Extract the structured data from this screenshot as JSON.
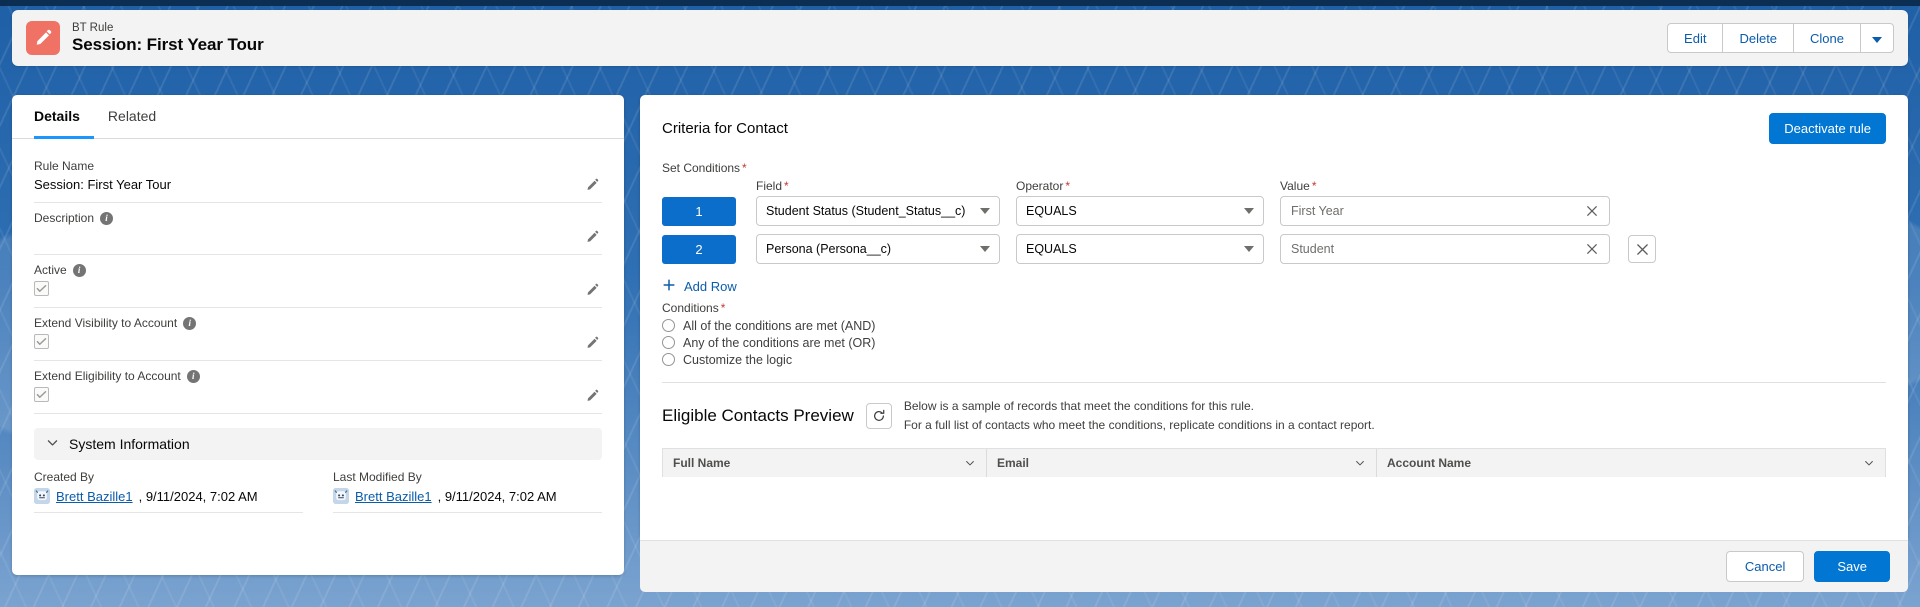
{
  "header": {
    "object_icon": "pencil-icon",
    "eyebrow": "BT Rule",
    "title": "Session: First Year Tour",
    "actions": {
      "edit": "Edit",
      "delete": "Delete",
      "clone": "Clone",
      "more": "chevron-down-icon"
    }
  },
  "details": {
    "tabs": [
      {
        "label": "Details",
        "active": true
      },
      {
        "label": "Related",
        "active": false
      }
    ],
    "fields": [
      {
        "label": "Rule Name",
        "value": "Session: First Year Tour",
        "type": "text",
        "has_info": false
      },
      {
        "label": "Description",
        "value": "",
        "type": "text",
        "has_info": true
      },
      {
        "label": "Active",
        "value": "",
        "type": "checkbox",
        "checked": true,
        "has_info": true
      },
      {
        "label": "Extend Visibility to Account",
        "value": "",
        "type": "checkbox",
        "checked": true,
        "has_info": true
      },
      {
        "label": "Extend Eligibility to Account",
        "value": "",
        "type": "checkbox",
        "checked": true,
        "has_info": true
      }
    ],
    "system_information": {
      "section_title": "System Information",
      "created_by": {
        "label": "Created By",
        "user": "Brett Bazille1",
        "timestamp": ", 9/11/2024, 7:02 AM"
      },
      "last_modified_by": {
        "label": "Last Modified By",
        "user": "Brett Bazille1",
        "timestamp": ", 9/11/2024, 7:02 AM"
      }
    }
  },
  "criteria": {
    "title": "Criteria for Contact",
    "deactivate_label": "Deactivate rule",
    "set_conditions_label": "Set Conditions",
    "column_headers": {
      "field": "Field",
      "operator": "Operator",
      "value": "Value"
    },
    "rows": [
      {
        "index": "1",
        "field": "Student Status (Student_Status__c)",
        "operator": "EQUALS",
        "value": "First Year",
        "has_delete": false
      },
      {
        "index": "2",
        "field": "Persona (Persona__c)",
        "operator": "EQUALS",
        "value": "Student",
        "has_delete": true
      }
    ],
    "add_row_label": "Add Row",
    "conditions_label": "Conditions",
    "condition_options": [
      {
        "label": "All of the conditions are met (AND)",
        "selected": false
      },
      {
        "label": "Any of the conditions are met (OR)",
        "selected": false
      },
      {
        "label": "Customize the logic",
        "selected": false
      }
    ]
  },
  "preview": {
    "title": "Eligible Contacts Preview",
    "refresh_icon": "refresh-icon",
    "note_line1": "Below is a sample of records that meet the conditions for this rule.",
    "note_line2": "For a full list of contacts who meet the conditions, replicate conditions in a contact report.",
    "columns": [
      {
        "label": "Full Name"
      },
      {
        "label": "Email"
      },
      {
        "label": "Account Name"
      }
    ],
    "rows": []
  },
  "footer": {
    "cancel_label": "Cancel",
    "save_label": "Save"
  },
  "colors": {
    "brand_blue": "#0176d3",
    "link_blue": "#0b5cab",
    "badge_blue": "#0b6ecb",
    "object_icon": "#ef7264",
    "required_red": "#c23934",
    "tab_underline": "#1b96ff"
  }
}
